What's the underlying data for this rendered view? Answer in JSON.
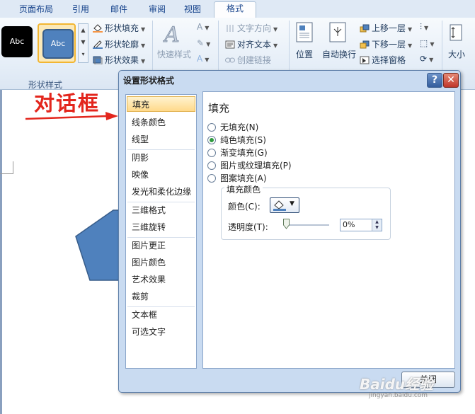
{
  "ribbon": {
    "tabs": [
      {
        "label": "页面布局",
        "active": false
      },
      {
        "label": "引用",
        "active": false
      },
      {
        "label": "邮件",
        "active": false
      },
      {
        "label": "审阅",
        "active": false
      },
      {
        "label": "视图",
        "active": false
      },
      {
        "label": "格式",
        "active": true
      }
    ],
    "shape_styles": {
      "style1_label": "Abc",
      "style2_label": "Abc",
      "fill_label": "形状填充",
      "outline_label": "形状轮廓",
      "effects_label": "形状效果",
      "group_label": "形状样式"
    },
    "wordart": {
      "quick_styles_label": "快速样式"
    },
    "text": {
      "direction_label": "文字方向",
      "align_label": "对齐文本",
      "link_label": "创建链接"
    },
    "arrange": {
      "position_label": "位置",
      "wrap_label": "自动换行",
      "bring_forward_label": "上移一层",
      "send_backward_label": "下移一层",
      "selection_pane_label": "选择窗格"
    },
    "size": {
      "label": "大小"
    }
  },
  "annotation": {
    "text": "对话框",
    "color": "#e3261d"
  },
  "shape": {
    "color": "#4f81bd"
  },
  "dialog": {
    "title": "设置形状格式",
    "help": "?",
    "nav_items": [
      "填充",
      "线条颜色",
      "线型",
      "阴影",
      "映像",
      "发光和柔化边缘",
      "三维格式",
      "三维旋转",
      "图片更正",
      "图片颜色",
      "艺术效果",
      "裁剪",
      "文本框",
      "可选文字"
    ],
    "selected_nav": "填充",
    "panel_title": "填充",
    "fill_options": [
      {
        "label": "无填充(N)",
        "selected": false
      },
      {
        "label": "纯色填充(S)",
        "selected": true
      },
      {
        "label": "渐变填充(G)",
        "selected": false
      },
      {
        "label": "图片或纹理填充(P)",
        "selected": false
      },
      {
        "label": "图案填充(A)",
        "selected": false
      }
    ],
    "fill_color_group": "填充颜色",
    "color_label": "颜色(C):",
    "transparency_label": "透明度(T):",
    "transparency_value": "0%",
    "close_label": "关闭"
  },
  "watermark": {
    "text": "Baidu经验",
    "sub": "jingyan.baidu.com"
  }
}
